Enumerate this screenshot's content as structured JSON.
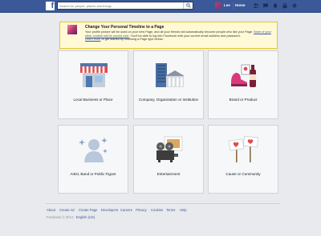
{
  "topbar": {
    "logo": "f",
    "search_placeholder": "Search for people, places and things",
    "user_name": "Lee",
    "home_label": "Home",
    "icons": [
      "friend-requests-icon",
      "messages-icon",
      "notifications-icon",
      "privacy-shortcuts-icon",
      "settings-icon"
    ]
  },
  "notice": {
    "title": "Change Your Personal Timeline to a Page",
    "body_1": "Your profile picture will be used on your new Page, and all your friends will automatically become people who like your Page.",
    "link_1": "None of your other content will be moved over.",
    "body_2": "You'll be able to log into Facebook with your current email address and password.",
    "link_2": "Learn more",
    "body_3": "or get started by choosing a Page type below:"
  },
  "categories": [
    {
      "label": "Local Business or Place"
    },
    {
      "label": "Company, Organization or Institution"
    },
    {
      "label": "Brand or Product"
    },
    {
      "label": "Artist, Band or Public Figure"
    },
    {
      "label": "Entertainment"
    },
    {
      "label": "Cause or Community"
    }
  ],
  "footer": {
    "links": [
      "About",
      "Create Ad",
      "Create Page",
      "Developers",
      "Careers",
      "Privacy",
      "Cookies",
      "Terms",
      "Help"
    ],
    "copyright": "Facebook © 2014 ·",
    "language": "English (US)"
  },
  "colors": {
    "brand_blue": "#3b5998",
    "background": "#e9eaed",
    "notice_bg": "#fff9d7"
  }
}
